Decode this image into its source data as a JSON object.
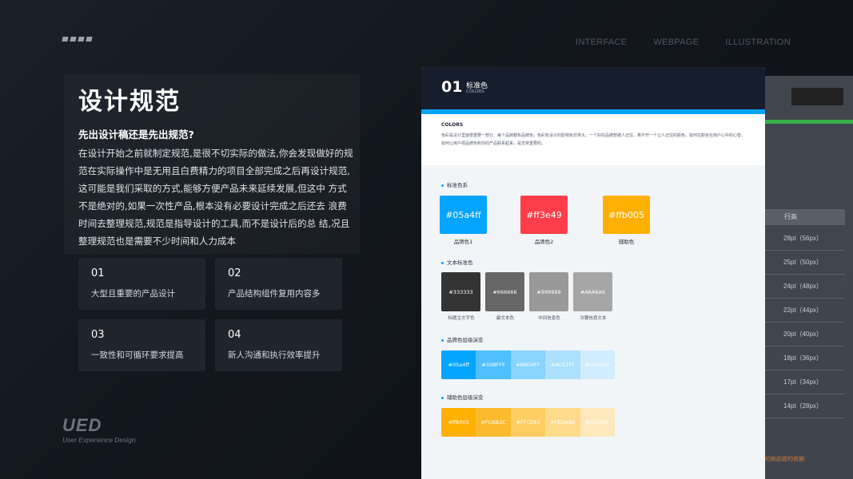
{
  "nav": {
    "items": [
      "INTERFACE",
      "WEBPAGE",
      "ILLUSTRATION"
    ]
  },
  "left": {
    "title": "设计规范",
    "subtitle": "先出设计稿还是先出规范?",
    "body": "在设计开始之前就制定规范,是很不切实际的做法,你会发现做好的规范在实际操作中是无用且白费精力的项目全部完成之后再设计规范,这可能是我们采取的方式,能够方便产品未来延续发展,但这中 方式不是绝对的,如果一次性产品,根本没有必要设计完成之后还去 浪费时间去整理规范,规范是指导设计的工具,而不是设计后的总 结,况且整理规范也是需要不少时间和人力成本",
    "cards": [
      {
        "num": "01",
        "label": "大型且重要的产品设计"
      },
      {
        "num": "02",
        "label": "产品结构组件复用内容多"
      },
      {
        "num": "03",
        "label": "一致性和可循环要求提高"
      },
      {
        "num": "04",
        "label": "新人沟通和执行效率提升"
      }
    ],
    "brand": {
      "word": "UED",
      "sub": "User Experience Design"
    }
  },
  "spec": {
    "number": "01",
    "title": "标准色",
    "subtitle": "COLORS",
    "intro_heading": "COLORS",
    "intro_text": "色彩是设计里面很重要一部分，每个品牌都有品牌色，色彩有设计的影响色非常大，一个好的品牌想被人记住，离不开一个让人记住的颜色，如何在颜色在用户心中的心智，如何让用户把品牌色和你的产品联系起来，是非常重要的。",
    "section_brand": "标准色系",
    "section_text": "文本标准色",
    "section_brand_ramp": "品牌色层级演变",
    "section_assist_ramp": "辅助色层级演变",
    "brand_colors": [
      {
        "hex": "#05a4ff",
        "label": "#05a4ff",
        "caption": "品牌色1"
      },
      {
        "hex": "#ff3e49",
        "label": "#ff3e49",
        "caption": "品牌色2"
      },
      {
        "hex": "#ffb005",
        "label": "#ffb005",
        "caption": "辅助色"
      }
    ],
    "text_colors": [
      {
        "hex": "#333333",
        "label": "#333333",
        "caption": "标题主文字色"
      },
      {
        "hex": "#666666",
        "label": "#666666",
        "caption": "副文本色"
      },
      {
        "hex": "#999999",
        "label": "#999999",
        "caption": "中间信息色"
      },
      {
        "hex": "#A6A6A6",
        "label": "#A6A6A6",
        "caption": "次要信息文本"
      }
    ],
    "brand_ramp": [
      {
        "hex": "#05a4ff",
        "label": "#05a4ff"
      },
      {
        "hex": "#50BFFF",
        "label": "#50BFFF"
      },
      {
        "hex": "#88D4FF",
        "label": "#88D4FF"
      },
      {
        "hex": "#ACE1FF",
        "label": "#ACE1FF"
      },
      {
        "hex": "#D1EDFF",
        "label": "#D1EDFF"
      }
    ],
    "assist_ramp": [
      {
        "hex": "#ffb005",
        "label": "#ffb005"
      },
      {
        "hex": "#FCBB2C",
        "label": "#FCBB2C"
      },
      {
        "hex": "#FFCE63",
        "label": "#FFCE63"
      },
      {
        "hex": "#FEDA8A",
        "label": "#FEDA8A"
      },
      {
        "hex": "#FEE8BC",
        "label": "#FEE8BC"
      }
    ]
  },
  "background_table": {
    "header": "行高",
    "rows": [
      "28pt（56px）",
      "25pt（50px）",
      "24pt（48px）",
      "22pt（44px）",
      "20pt（40px）",
      "18pt（36px）",
      "17pt（34px）",
      "14pt（28px）"
    ],
    "footer": "的和品提的依据"
  }
}
